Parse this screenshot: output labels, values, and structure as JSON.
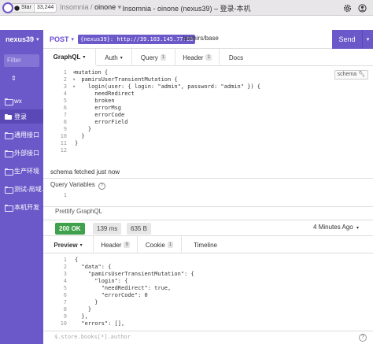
{
  "titlebar": {
    "star_label": "Star",
    "star_count": "33,244",
    "workspace": "Insomnia",
    "separator": "/",
    "project": "oinone",
    "caret": "▾",
    "window_title": "Insomnia - oinone (nexus39) – 登录-本机"
  },
  "sidebar": {
    "environment": "nexus39",
    "caret": "▾",
    "filter_placeholder": "Filter",
    "sort_icon": "⇕",
    "items": [
      {
        "label": "wx",
        "icon": "folder-icon",
        "active": false
      },
      {
        "label": "登录",
        "icon": "folder-open-icon",
        "active": true
      },
      {
        "label": "通用接口",
        "icon": "folder-icon",
        "active": false
      },
      {
        "label": "外部接口",
        "icon": "folder-icon",
        "active": false
      },
      {
        "label": "生产环境",
        "icon": "folder-icon",
        "active": false
      },
      {
        "label": "测试-局域...",
        "icon": "folder-icon",
        "active": false
      },
      {
        "label": "本机开发",
        "icon": "folder-icon",
        "active": false
      }
    ]
  },
  "request": {
    "method": "POST",
    "caret": "▾",
    "url_var": "{nexus39}: http://39.103.145.77:88",
    "url_path": "/pamirs/base",
    "send_label": "Send",
    "send_caret": "▾"
  },
  "request_tabs": [
    {
      "label": "GraphQL",
      "badge": "",
      "caret": "▾",
      "active": true
    },
    {
      "label": "Auth",
      "badge": "",
      "caret": "▾",
      "active": false
    },
    {
      "label": "Query",
      "badge": "1",
      "caret": "",
      "active": false
    },
    {
      "label": "Header",
      "badge": "1",
      "caret": "",
      "active": false
    },
    {
      "label": "Docs",
      "badge": "",
      "caret": "",
      "active": false
    }
  ],
  "editor": {
    "schema_label": "schema",
    "lines": [
      {
        "n": "1",
        "text": "mutation {"
      },
      {
        "n": "2",
        "text": "  pamirsUserTransientMutation {"
      },
      {
        "n": "3",
        "text": "    login(user: { login: \"admin\", password: \"admin\" }) {"
      },
      {
        "n": "4",
        "text": "      needRedirect"
      },
      {
        "n": "5",
        "text": "      broken"
      },
      {
        "n": "6",
        "text": "      errorMsg"
      },
      {
        "n": "7",
        "text": "      errorCode"
      },
      {
        "n": "8",
        "text": "      errorField"
      },
      {
        "n": "9",
        "text": "    }"
      },
      {
        "n": "10",
        "text": "  }"
      },
      {
        "n": "11",
        "text": "}"
      },
      {
        "n": "12",
        "text": ""
      }
    ],
    "fold_markers": [
      "▾",
      "▾",
      "▾"
    ]
  },
  "schema_status": "schema fetched just now",
  "query_variables": {
    "label": "Query Variables",
    "help": "?",
    "line": "1"
  },
  "prettify_label": "Prettify GraphQL",
  "response": {
    "status": "200 OK",
    "time": "139 ms",
    "size": "635 B",
    "ago": "4 Minutes Ago",
    "caret": "▾",
    "tabs": [
      {
        "label": "Preview",
        "badge": "",
        "caret": "▾",
        "active": true
      },
      {
        "label": "Header",
        "badge": "9",
        "caret": "",
        "active": false
      },
      {
        "label": "Cookie",
        "badge": "1",
        "caret": "",
        "active": false
      },
      {
        "label": "Timeline",
        "badge": "",
        "caret": "",
        "active": false
      }
    ],
    "lines": [
      {
        "n": "1",
        "text": "{"
      },
      {
        "n": "2",
        "text": "  \"data\": {"
      },
      {
        "n": "3",
        "text": "    \"pamirsUserTransientMutation\": {"
      },
      {
        "n": "4",
        "text": "      \"login\": {"
      },
      {
        "n": "5",
        "text": "        \"needRedirect\": true,"
      },
      {
        "n": "6",
        "text": "        \"errorCode\": 0"
      },
      {
        "n": "7",
        "text": "      }"
      },
      {
        "n": "8",
        "text": "    }"
      },
      {
        "n": "9",
        "text": "  },"
      },
      {
        "n": "10",
        "text": "  \"errors\": [],"
      }
    ],
    "filter_placeholder": "$.store.books[*].author",
    "help": "?"
  },
  "colors": {
    "brand": "#6b58c9",
    "sidebar_active": "#5a48b6",
    "status_ok": "#3fa14b",
    "method": "#6c4bd8"
  }
}
